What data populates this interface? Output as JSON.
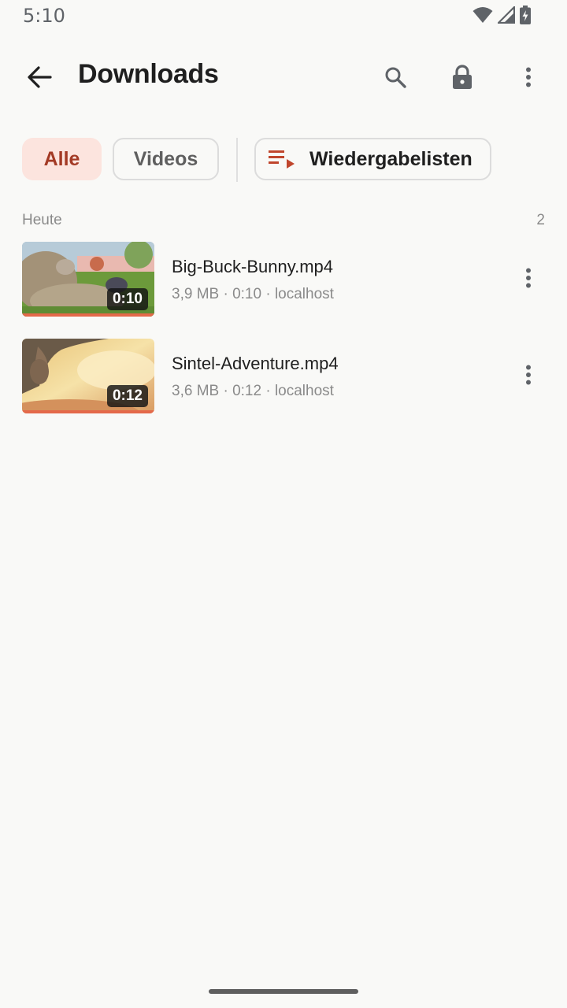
{
  "status_bar": {
    "time": "5:10",
    "icons": [
      "wifi-icon",
      "signal-icon",
      "battery-charging-icon"
    ]
  },
  "app_bar": {
    "back_icon": "arrow-back-icon",
    "title": "Downloads",
    "actions": [
      "search-icon",
      "lock-icon",
      "more-vert-icon"
    ]
  },
  "filters": {
    "all_label": "Alle",
    "videos_label": "Videos",
    "playlists_label": "Wiedergabelisten",
    "selected": "Alle"
  },
  "section": {
    "title": "Heute",
    "count": "2"
  },
  "items": [
    {
      "title": "Big-Buck-Bunny.mp4",
      "meta": "3,9 MB · 0:10 · localhost",
      "duration": "0:10",
      "progress": 1.0
    },
    {
      "title": "Sintel-Adventure.mp4",
      "meta": "3,6 MB · 0:12 · localhost",
      "duration": "0:12",
      "progress": 1.0
    }
  ],
  "colors": {
    "accent": "#a33a25",
    "accent_bg": "#fce4de",
    "progress": "#e4694a",
    "icon": "#5f6368"
  }
}
